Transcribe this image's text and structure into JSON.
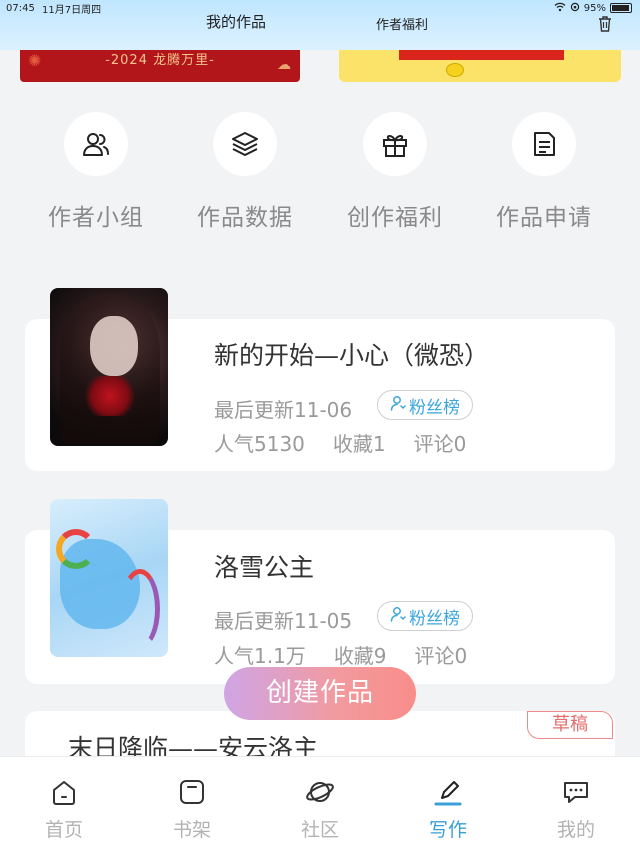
{
  "status_bar": {
    "time": "07:45",
    "date": "11月7日周四",
    "battery": "95%",
    "battery_level": 0.95
  },
  "header": {
    "title_left": "我的作品",
    "title_right": "作者福利"
  },
  "banner": {
    "left_text": "-2024 龙腾万里-"
  },
  "quick_actions": [
    {
      "label": "作者小组",
      "icon": "group-icon"
    },
    {
      "label": "作品数据",
      "icon": "layers-icon"
    },
    {
      "label": "创作福利",
      "icon": "gift-icon"
    },
    {
      "label": "作品申请",
      "icon": "document-icon"
    }
  ],
  "works": [
    {
      "title": "新的开始—小心（微恐）",
      "updated": "最后更新11-06",
      "fans_label": "粉丝榜",
      "popularity": "人气5130",
      "favorites": "收藏1",
      "comments": "评论0"
    },
    {
      "title": "洛雪公主",
      "updated": "最后更新11-05",
      "fans_label": "粉丝榜",
      "popularity": "人气1.1万",
      "favorites": "收藏9",
      "comments": "评论0"
    },
    {
      "title": "末日降临——安云洛主",
      "draft_label": "草稿"
    }
  ],
  "create_button": "创建作品",
  "tabbar": [
    {
      "label": "首页",
      "icon": "home-icon",
      "active": false
    },
    {
      "label": "书架",
      "icon": "bookshelf-icon",
      "active": false
    },
    {
      "label": "社区",
      "icon": "planet-icon",
      "active": false
    },
    {
      "label": "写作",
      "icon": "pen-icon",
      "active": true
    },
    {
      "label": "我的",
      "icon": "chat-bubble-icon",
      "active": false
    }
  ],
  "colors": {
    "accent": "#3a9fd8",
    "draft": "#e46c6c",
    "header_bg": "#bfe6ff"
  }
}
